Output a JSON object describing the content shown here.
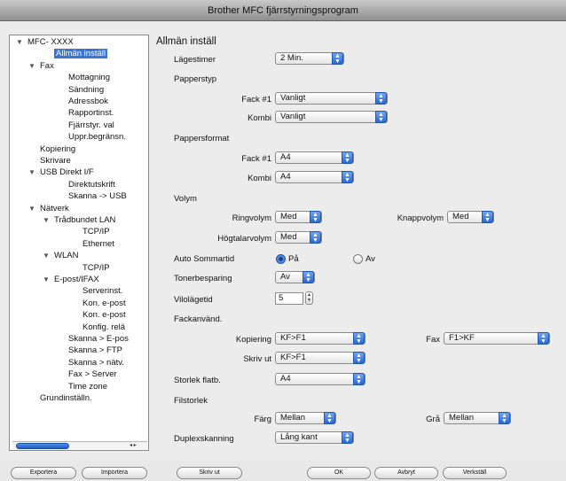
{
  "window": {
    "title": "Brother MFC fjärrstyrningsprogram"
  },
  "tree": {
    "items": [
      {
        "label": "MFC- XXXX",
        "level": 0,
        "expanded": true
      },
      {
        "label": "Allmän inställ",
        "level": 2,
        "selected": true
      },
      {
        "label": "Fax",
        "level": 1,
        "expanded": true
      },
      {
        "label": "Mottagning",
        "level": 3
      },
      {
        "label": "Sändning",
        "level": 3
      },
      {
        "label": "Adressbok",
        "level": 3
      },
      {
        "label": "Rapportinst.",
        "level": 3
      },
      {
        "label": "Fjärrstyr. val",
        "level": 3
      },
      {
        "label": "Uppr.begränsn.",
        "level": 3
      },
      {
        "label": "Kopiering",
        "level": 1
      },
      {
        "label": "Skrivare",
        "level": 1
      },
      {
        "label": "USB Direkt I/F",
        "level": 1,
        "expanded": true
      },
      {
        "label": "Direktutskrift",
        "level": 3
      },
      {
        "label": "Skanna -> USB",
        "level": 3
      },
      {
        "label": "Nätverk",
        "level": 1,
        "expanded": true
      },
      {
        "label": "Trådbundet LAN",
        "level": 2,
        "expanded": true
      },
      {
        "label": "TCP/IP",
        "level": 4
      },
      {
        "label": "Ethernet",
        "level": 4
      },
      {
        "label": "WLAN",
        "level": 2,
        "expanded": true
      },
      {
        "label": "TCP/IP",
        "level": 4
      },
      {
        "label": "E-post/IFAX",
        "level": 2,
        "expanded": true
      },
      {
        "label": "Serverinst.",
        "level": 4
      },
      {
        "label": "Kon. e-post",
        "level": 4
      },
      {
        "label": "Kon. e-post",
        "level": 4
      },
      {
        "label": "Konfig. relä",
        "level": 4
      },
      {
        "label": "Skanna > E-pos",
        "level": 3
      },
      {
        "label": "Skanna > FTP",
        "level": 3
      },
      {
        "label": "Skanna > nätv.",
        "level": 3
      },
      {
        "label": "Fax > Server",
        "level": 3
      },
      {
        "label": "Time zone",
        "level": 3
      },
      {
        "label": "Grundinställn.",
        "level": 1
      }
    ],
    "scroll_arrows": "◂ ▸"
  },
  "main": {
    "heading": "Allmän inställ",
    "lagestimer": {
      "label": "Lägestimer",
      "value": "2 Min."
    },
    "papperstyp": {
      "label": "Papperstyp",
      "fack1_label": "Fack #1",
      "fack1_value": "Vanligt",
      "kombi_label": "Kombi",
      "kombi_value": "Vanligt"
    },
    "pappersformat": {
      "label": "Pappersformat",
      "fack1_label": "Fack #1",
      "fack1_value": "A4",
      "kombi_label": "Kombi",
      "kombi_value": "A4"
    },
    "volym": {
      "label": "Volym",
      "ringvolym_label": "Ringvolym",
      "ringvolym_value": "Med",
      "knappvolym_label": "Knappvolym",
      "knappvolym_value": "Med",
      "hogtalarvolym_label": "Högtalarvolym",
      "hogtalarvolym_value": "Med"
    },
    "auto_sommartid": {
      "label": "Auto Sommartid",
      "on_label": "På",
      "off_label": "Av",
      "selected": "På"
    },
    "tonerbesparing": {
      "label": "Tonerbesparing",
      "value": "Av"
    },
    "vilolagetid": {
      "label": "Vilolägetid",
      "value": "5"
    },
    "fackanvand": {
      "label": "Fackanvänd.",
      "kopiering_label": "Kopiering",
      "kopiering_value": "KF>F1",
      "fax_label": "Fax",
      "fax_value": "F1>KF",
      "skrivut_label": "Skriv ut",
      "skrivut_value": "KF>F1"
    },
    "storlek_flatb": {
      "label": "Storlek flatb.",
      "value": "A4"
    },
    "filstorlek": {
      "label": "Filstorlek",
      "farg_label": "Färg",
      "farg_value": "Mellan",
      "gra_label": "Grå",
      "gra_value": "Mellan"
    },
    "duplexskanning": {
      "label": "Duplexskanning",
      "value": "Lång kant"
    }
  },
  "buttons": {
    "exportera": "Exportera",
    "importera": "Importera",
    "skriv_ut": "Skriv ut",
    "ok": "OK",
    "avbryt": "Avbryt",
    "verkstall": "Verkställ"
  },
  "colors": {
    "accent": "#2a68d2",
    "selection": "#3875d7"
  },
  "icons": {
    "popup_arrow": "up-down-arrows",
    "tree_disclosure": "triangle-down"
  }
}
